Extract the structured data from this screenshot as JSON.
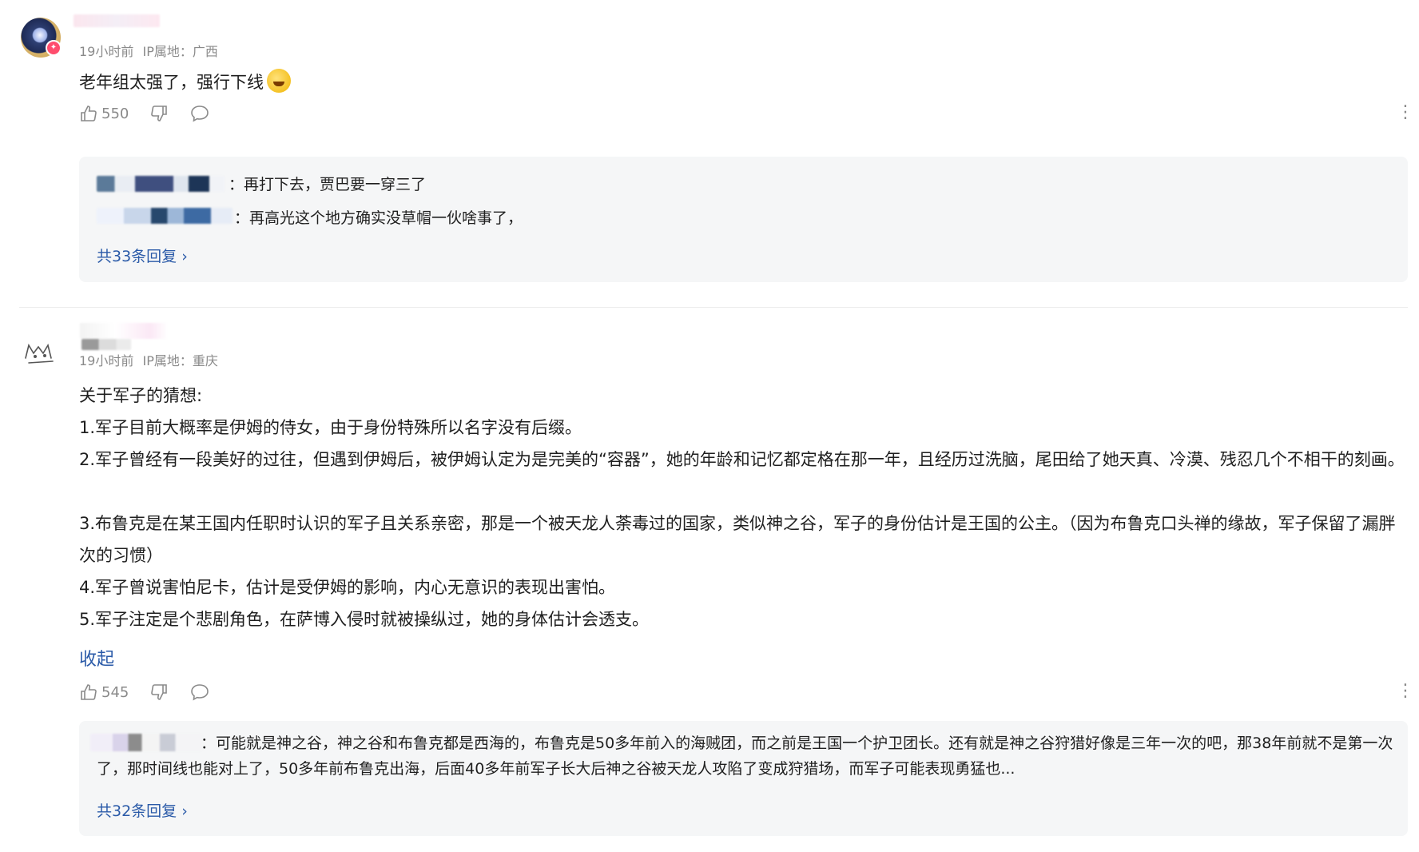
{
  "comments": [
    {
      "time": "19小时前",
      "ip_location": "IP属地：广西",
      "content": "老年组太强了，强行下线",
      "emoji_icon": "laughing-tears-emoji",
      "likes": "550",
      "replies": [
        {
          "text": "：再打下去，贾巴要一穿三了"
        },
        {
          "text": "：再高光这个地方确实没草帽一伙啥事了，"
        }
      ],
      "reply_count_label": "共33条回复 ›"
    },
    {
      "time": "19小时前",
      "ip_location": "IP属地：重庆",
      "content_lines": [
        "关于军子的猜想:",
        "1.军子目前大概率是伊姆的侍女，由于身份特殊所以名字没有后缀。",
        "2.军子曾经有一段美好的过往，但遇到伊姆后，被伊姆认定为是完美的“容器”，她的年龄和记忆都定格在那一年，且经历过洗脑，尾田给了她天真、冷漠、残忍几个不相干的刻画。",
        "3.布鲁克是在某王国内任职时认识的军子且关系亲密，那是一个被天龙人荼毒过的国家，类似神之谷，军子的身份估计是王国的公主。（因为布鲁克口头禅的缘故，军子保留了漏胖次的习惯）",
        "4.军子曾说害怕尼卡，估计是受伊姆的影响，内心无意识的表现出害怕。",
        "5.军子注定是个悲剧角色，在萨博入侵时就被操纵过，她的身体估计会透支。"
      ],
      "collapse_label": "收起",
      "likes": "545",
      "reply_text": "：可能就是神之谷，神之谷和布鲁克都是西海的，布鲁克是50多年前入的海贼团，而之前是王国一个护卫团长。还有就是神之谷狩猎好像是三年一次的吧，那38年前就不是第一次了，那时间线也能对上了，50多年前布鲁克出海，后面40多年前军子长大后神之谷被天龙人攻陷了变成狩猎场，而军子可能表现勇猛也...",
      "reply_count_label": "共32条回复 ›"
    }
  ],
  "colors": {
    "link": "#2a5aa8",
    "meta": "#8a8a8a",
    "reply_bg": "#f5f6f7"
  }
}
